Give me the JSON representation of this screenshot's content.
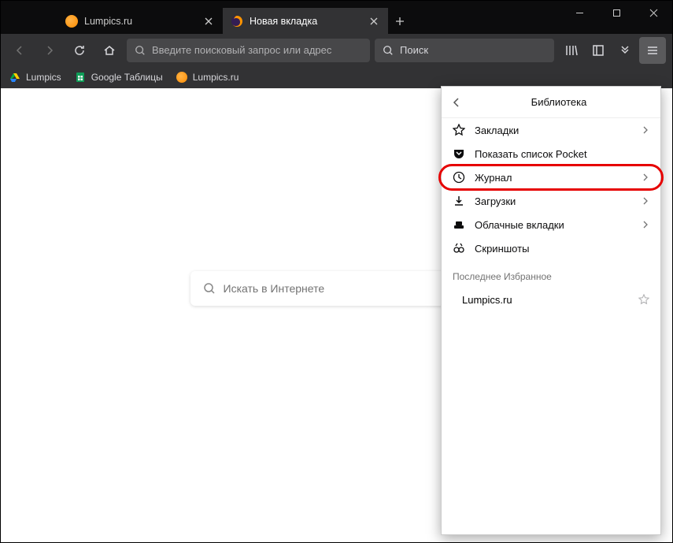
{
  "tabs": [
    {
      "label": "Lumpics.ru",
      "active": false
    },
    {
      "label": "Новая вкладка",
      "active": true
    }
  ],
  "urlbar": {
    "placeholder": "Введите поисковый запрос или адрес"
  },
  "searchbar": {
    "placeholder": "Поиск"
  },
  "bookmarks": [
    {
      "label": "Lumpics"
    },
    {
      "label": "Google Таблицы"
    },
    {
      "label": "Lumpics.ru"
    }
  ],
  "content_search": {
    "placeholder": "Искать в Интернете"
  },
  "panel": {
    "title": "Библиотека",
    "items": [
      {
        "label": "Закладки",
        "arrow": true
      },
      {
        "label": "Показать список Pocket",
        "arrow": false
      },
      {
        "label": "Журнал",
        "arrow": true
      },
      {
        "label": "Загрузки",
        "arrow": true
      },
      {
        "label": "Облачные вкладки",
        "arrow": true
      },
      {
        "label": "Скриншоты",
        "arrow": false
      }
    ],
    "recent_label": "Последнее Избранное",
    "recent": [
      {
        "label": "Lumpics.ru"
      }
    ]
  }
}
